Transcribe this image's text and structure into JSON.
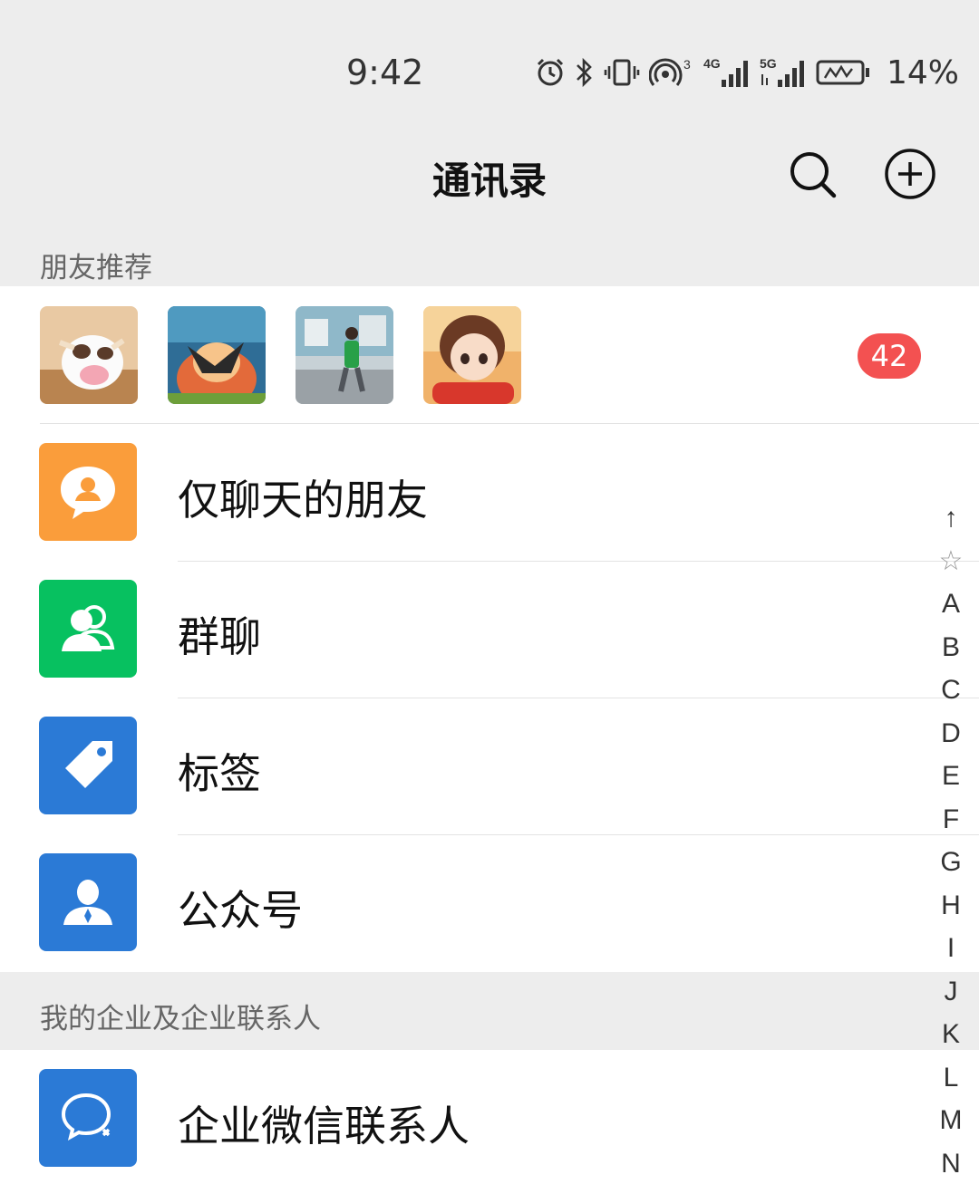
{
  "status_bar": {
    "time": "9:42",
    "battery_percent": "14%",
    "icons": [
      "alarm-icon",
      "bluetooth-icon",
      "vibrate-icon",
      "hotspot-icon",
      "signal-4g-icon",
      "signal-5g-icon",
      "battery-icon"
    ],
    "sim1_network": "4G",
    "sim2_network": "5G",
    "hotspot_count": "3"
  },
  "header": {
    "title": "通讯录",
    "search_icon": "search-icon",
    "add_icon": "plus-circle-icon"
  },
  "friend_recommend": {
    "section_title": "朋友推荐",
    "avatar_count": 4,
    "badge": "42"
  },
  "menu": {
    "items": [
      {
        "label": "仅聊天的朋友",
        "icon": "chat-only-friend-icon",
        "color": "#fa9d3b"
      },
      {
        "label": "群聊",
        "icon": "group-icon",
        "color": "#07c160"
      },
      {
        "label": "标签",
        "icon": "tag-icon",
        "color": "#2b7ad6"
      },
      {
        "label": "公众号",
        "icon": "official-account-icon",
        "color": "#2b7ad6"
      }
    ]
  },
  "enterprise": {
    "section_title": "我的企业及企业联系人",
    "item_label": "企业微信联系人",
    "item_icon": "wecom-icon",
    "item_color": "#2b7ad6"
  },
  "index_bar": [
    "↑",
    "☆",
    "A",
    "B",
    "C",
    "D",
    "E",
    "F",
    "G",
    "H",
    "I",
    "J",
    "K",
    "L",
    "M",
    "N"
  ]
}
